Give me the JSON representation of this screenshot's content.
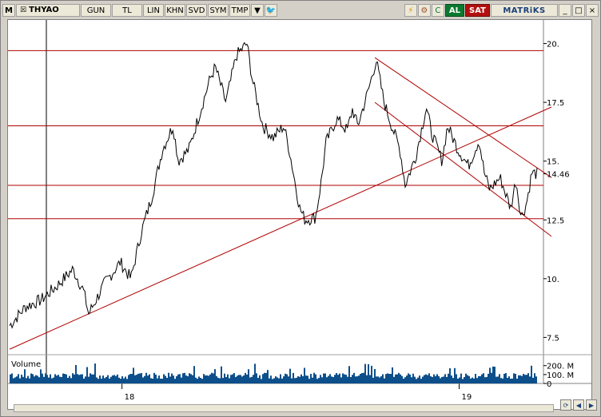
{
  "toolbar": {
    "m_label": "M",
    "symbol": "THYAO",
    "buttons": [
      "GUN",
      "TL",
      "LIN",
      "KHN",
      "SVD",
      "SYM",
      "TMP"
    ],
    "al_label": "AL",
    "sat_label": "SAT",
    "logo_text": "MATRiKS"
  },
  "colors": {
    "price_line": "#000000",
    "support_lines": "#b00000",
    "volume_bars": "#0d4f8b",
    "al": "#0b7a2f",
    "sat": "#b20f0f"
  },
  "chart_data": [
    {
      "type": "line",
      "series": [
        {
          "name": "THYAO",
          "color": "#000000"
        }
      ],
      "x": [
        "2017-09",
        "2017-10",
        "2017-11",
        "2017-12",
        "2018-01",
        "2018-02",
        "2018-03",
        "2018-04",
        "2018-05",
        "2018-06",
        "2018-07",
        "2018-08",
        "2018-09",
        "2018-10",
        "2018-11",
        "2018-12",
        "2019-01",
        "2019-02",
        "2019-03",
        "2019-04"
      ],
      "y_ticks": [
        "20.",
        "17.5",
        "15.",
        "12.5",
        "10.",
        "7.5"
      ],
      "x_ticks": [
        "18",
        "19"
      ],
      "ylim": [
        6.8,
        20.8
      ],
      "last_value": "14.46",
      "horizontal_lines": [
        19.7,
        16.5,
        13.97,
        12.55
      ],
      "trend_lines": [
        {
          "from": [
            "2017-09",
            7.0
          ],
          "to": [
            "2019-04",
            17.3
          ]
        },
        {
          "from": [
            "2018-10",
            19.4
          ],
          "to": [
            "2019-04",
            14.3
          ]
        },
        {
          "from": [
            "2018-10",
            17.5
          ],
          "to": [
            "2019-04",
            11.8
          ]
        }
      ]
    },
    {
      "type": "bar",
      "title": "Volume",
      "y_ticks": [
        "200. M",
        "100. M",
        "0"
      ],
      "ylim": [
        0,
        260
      ]
    }
  ]
}
